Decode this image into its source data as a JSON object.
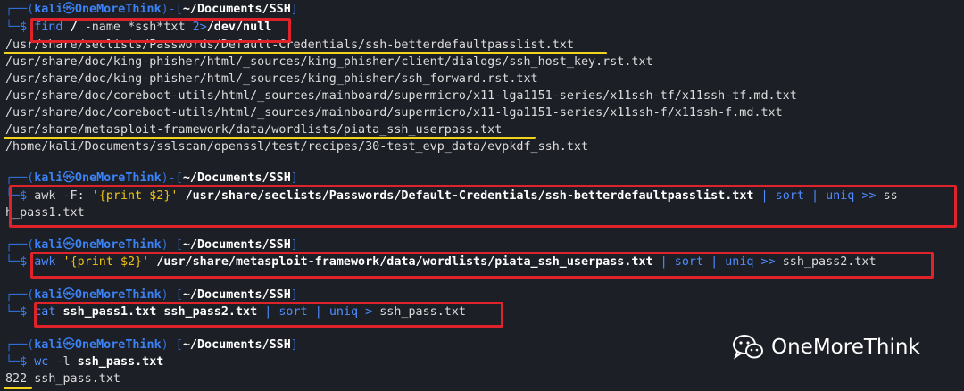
{
  "prompt": {
    "user": "kali",
    "sym": "㉿",
    "host": "OneMoreThink",
    "dir": "~/Documents/SSH"
  },
  "cmd1": {
    "find": "find",
    "root": "/",
    "name_flag": "-name",
    "pattern": "*ssh*txt",
    "redir": "2>",
    "devnull": "/dev/null"
  },
  "find_results": [
    "/usr/share/seclists/Passwords/Default-Credentials/ssh-betterdefaultpasslist.txt",
    "/usr/share/doc/king-phisher/html/_sources/king_phisher/client/dialogs/ssh_host_key.rst.txt",
    "/usr/share/doc/king-phisher/html/_sources/king_phisher/ssh_forward.rst.txt",
    "/usr/share/doc/coreboot-utils/html/_sources/mainboard/supermicro/x11-lga1151-series/x11ssh-tf/x11ssh-tf.md.txt",
    "/usr/share/doc/coreboot-utils/html/_sources/mainboard/supermicro/x11-lga1151-series/x11ssh-f/x11ssh-f.md.txt",
    "/usr/share/metasploit-framework/data/wordlists/piata_ssh_userpass.txt",
    "/home/kali/Documents/sslscan/openssl/test/recipes/30-test_evp_data/evpkdf_ssh.txt"
  ],
  "cmd2": {
    "awk": "awk",
    "flag": "-F:",
    "script": "'{print $2}'",
    "file": "/usr/share/seclists/Passwords/Default-Credentials/ssh-betterdefaultpasslist.txt",
    "sort": "sort",
    "uniq": "uniq",
    "append": ">>",
    "out_a": "ss",
    "out_b": "h_pass1.txt"
  },
  "cmd3": {
    "awk": "awk",
    "script": "'{print $2}'",
    "file": "/usr/share/metasploit-framework/data/wordlists/piata_ssh_userpass.txt",
    "sort": "sort",
    "uniq": "uniq",
    "append": ">>",
    "out": "ssh_pass2.txt"
  },
  "cmd4": {
    "cat": "cat",
    "f1": "ssh_pass1.txt",
    "f2": "ssh_pass2.txt",
    "sort": "sort",
    "uniq": "uniq",
    "redir": ">",
    "out": "ssh_pass.txt"
  },
  "cmd5": {
    "wc": "wc",
    "flag": "-l",
    "file": "ssh_pass.txt"
  },
  "wc_result": {
    "count": "822",
    "file": "ssh_pass.txt"
  },
  "watermark": {
    "text": "OneMoreThink",
    "icon": "wechat-icon"
  },
  "colors": {
    "highlight_box": "#e0222a",
    "underline": "#f2d21b",
    "prompt_blue": "#3b82f6",
    "background": "#1c1f26"
  }
}
